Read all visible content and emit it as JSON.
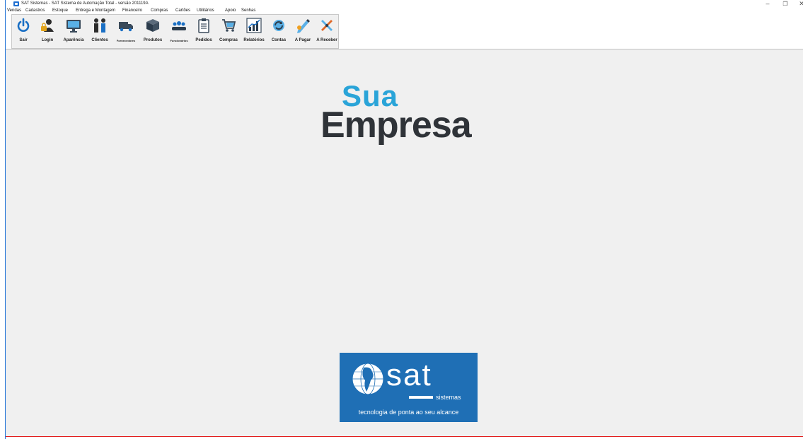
{
  "window": {
    "title": "SAT Sistemas - SAT Sistema de Automação Total - versão 201119A",
    "minimize_glyph": "–",
    "restore_glyph": "❐",
    "close_glyph": "✕"
  },
  "menu": {
    "items": [
      "Vendas",
      "Cadastros",
      "Estoque",
      "Entrega e Montagem",
      "Financeiro",
      "Compras",
      "Cartões",
      "Utilitários",
      "Apoio",
      "Senhas"
    ]
  },
  "toolbar": {
    "buttons": [
      {
        "label": "Sair",
        "icon": "power-icon"
      },
      {
        "label": "Login",
        "icon": "user-lock-icon"
      },
      {
        "label": "Aparência",
        "icon": "monitor-icon"
      },
      {
        "label": "Clientes",
        "icon": "people-icon"
      },
      {
        "label": "Fornecedores",
        "icon": "truck-icon"
      },
      {
        "label": "Produtos",
        "icon": "box-icon"
      },
      {
        "label": "Funcionários",
        "icon": "group-icon"
      },
      {
        "label": "Pedidos",
        "icon": "clipboard-icon"
      },
      {
        "label": "Compras",
        "icon": "cart-icon"
      },
      {
        "label": "Relatórios",
        "icon": "bar-chart-icon"
      },
      {
        "label": "Contas",
        "icon": "refresh-icon"
      },
      {
        "label": "A Pagar",
        "icon": "pen-icon"
      },
      {
        "label": "A Receber",
        "icon": "tools-icon"
      }
    ]
  },
  "branding": {
    "line1": "Sua",
    "line2": "Empresa",
    "sat_word": "sat",
    "sat_sub": "sistemas",
    "sat_tagline": "tecnologia de ponta ao seu alcance"
  },
  "colors": {
    "accent": "#2aa4d8",
    "dark_text": "#2f3338",
    "sat_blue": "#1f6fb5",
    "frame_blue": "#2a78d8",
    "alert_red": "#e21e1e"
  }
}
